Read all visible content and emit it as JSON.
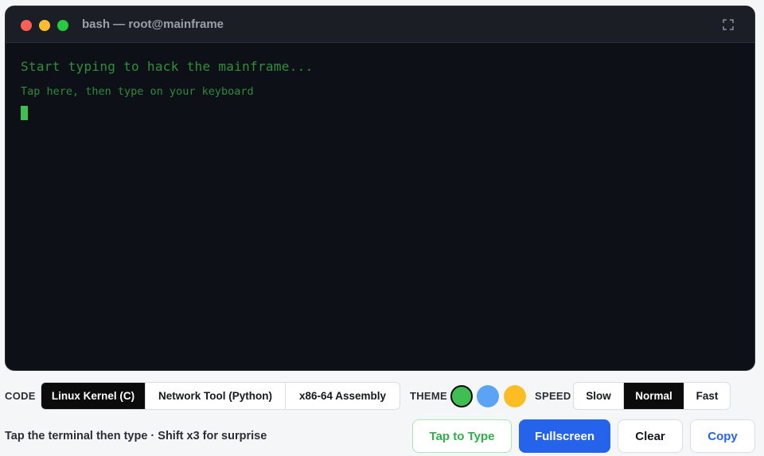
{
  "window": {
    "title": "bash — root@mainframe",
    "expand_icon": "expand-icon"
  },
  "terminal": {
    "prompt": "Start typing to hack the mainframe...",
    "hint": "Tap here, then type on your keyboard"
  },
  "controls": {
    "code_label": "CODE",
    "code_options": [
      "Linux Kernel (C)",
      "Network Tool (Python)",
      "x86-64 Assembly"
    ],
    "code_selected": "Linux Kernel (C)",
    "theme_label": "THEME",
    "theme_colors": [
      "#3fbf52",
      "#5ba4f5",
      "#fbbd23"
    ],
    "theme_selected": "#3fbf52",
    "speed_label": "SPEED",
    "speed_options": [
      "Slow",
      "Normal",
      "Fast"
    ],
    "speed_selected": "Normal"
  },
  "footer": {
    "help_text": "Tap the terminal then type · Shift x3 for surprise",
    "tap_label": "Tap to Type",
    "fullscreen_label": "Fullscreen",
    "clear_label": "Clear",
    "copy_label": "Copy"
  }
}
